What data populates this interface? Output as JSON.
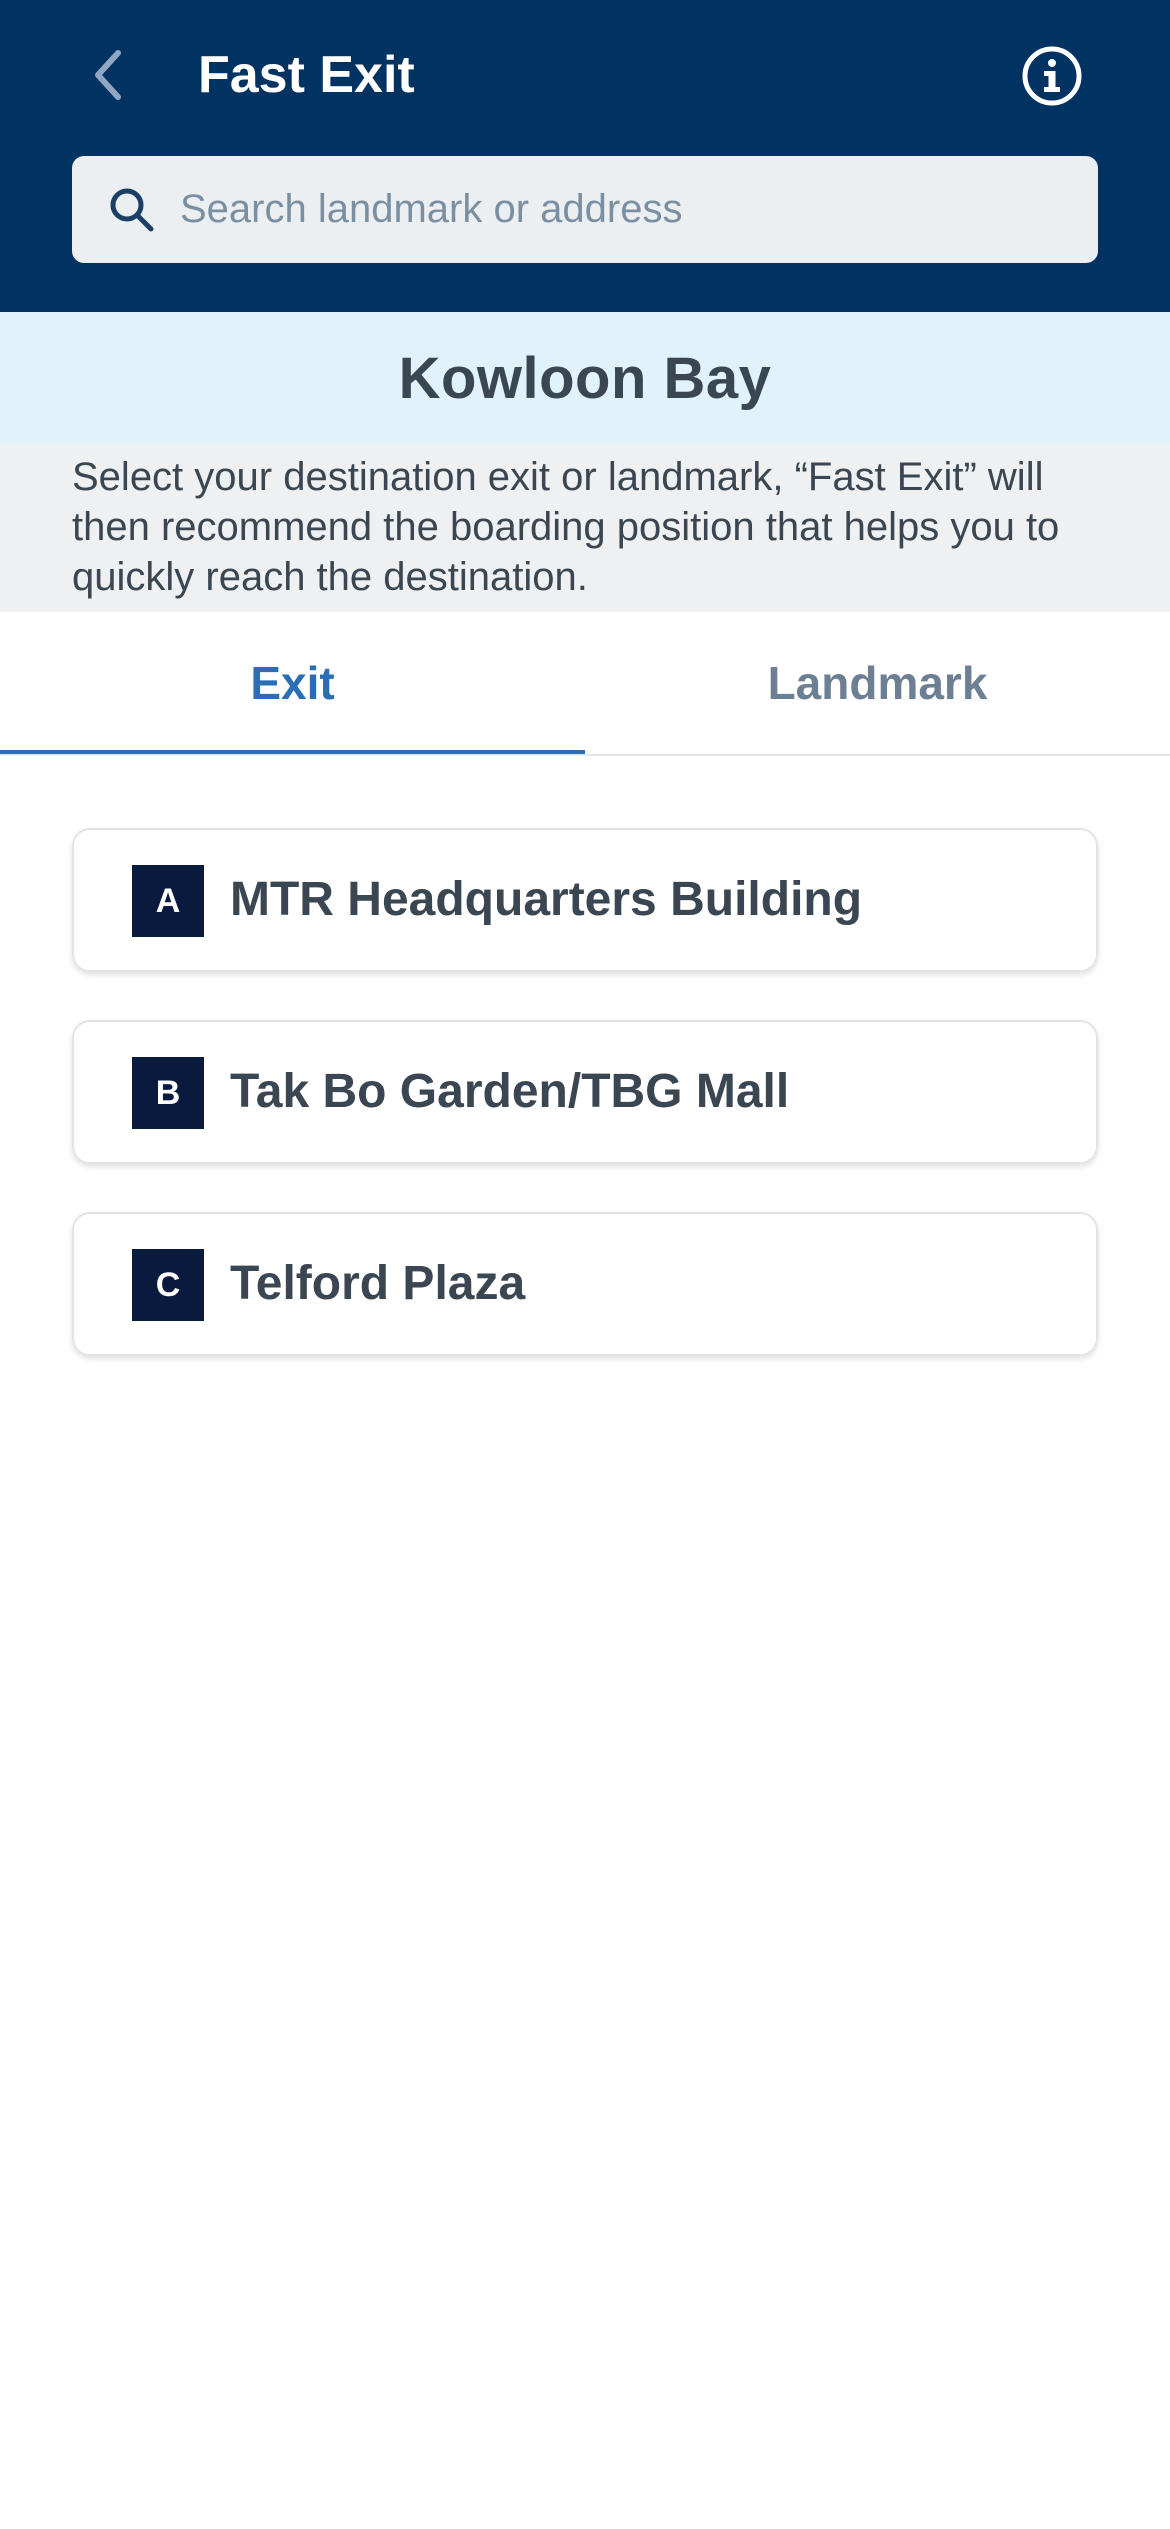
{
  "header": {
    "title": "Fast Exit",
    "background_color": "#003262"
  },
  "search": {
    "placeholder": "Search landmark or address",
    "value": ""
  },
  "station": {
    "name": "Kowloon Bay"
  },
  "instruction": {
    "text": "Select your destination exit or landmark, “Fast Exit” will then recommend the boarding position that helps you to quickly reach the destination."
  },
  "tabs": [
    {
      "label": "Exit",
      "active": true
    },
    {
      "label": "Landmark",
      "active": false
    }
  ],
  "exits": [
    {
      "code": "A",
      "name": "MTR Headquarters Building"
    },
    {
      "code": "B",
      "name": "Tak Bo Garden/TBG Mall"
    },
    {
      "code": "C",
      "name": "Telford Plaza"
    }
  ],
  "icons": {
    "back": "chevron-left-icon",
    "info": "info-circle-icon",
    "search": "search-icon"
  },
  "colors": {
    "accent": "#2a6fb5",
    "badge": "#0a1a3e",
    "banner": "#e0f3fb"
  }
}
